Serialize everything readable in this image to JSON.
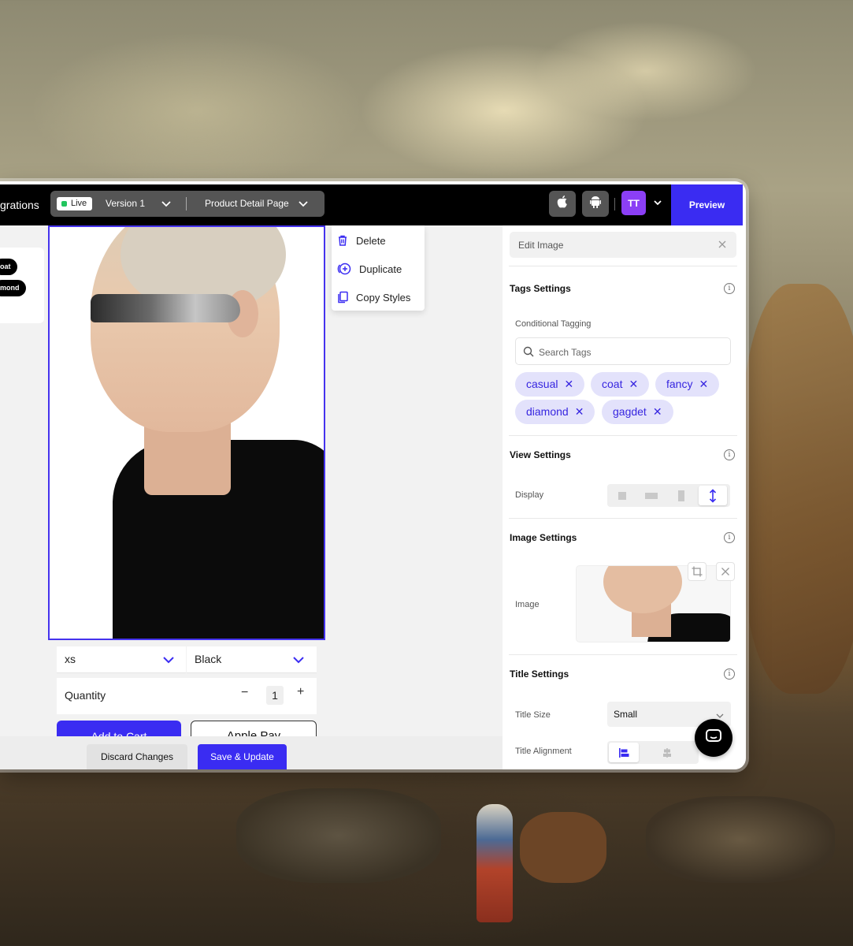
{
  "topbar": {
    "title_fragment": "grations",
    "live_label": "Live",
    "version_label": "Version 1",
    "page_label": "Product Detail Page",
    "avatar_initials": "TT",
    "preview_label": "Preview",
    "accent_color": "#3a2cf2"
  },
  "canvas": {
    "pills": [
      "oat",
      "mond"
    ],
    "size_select": "xs",
    "color_select": "Black",
    "quantity_label": "Quantity",
    "quantity_value": "1",
    "quantity_minus": "−",
    "quantity_plus": "+",
    "add_to_cart": "Add to Cart",
    "apple_pay": " Apple Pay"
  },
  "context_menu": {
    "items": [
      {
        "label": "Delete",
        "icon": "trash-icon"
      },
      {
        "label": "Duplicate",
        "icon": "plus-circle-icon"
      },
      {
        "label": "Copy Styles",
        "icon": "copy-icon"
      }
    ]
  },
  "bottombar": {
    "discard_label": "Discard Changes",
    "save_label": "Save & Update"
  },
  "panel": {
    "header": "Edit Image",
    "tags": {
      "title": "Tags Settings",
      "field_label": "Conditional Tagging",
      "search_placeholder": "Search Tags",
      "items": [
        "casual",
        "coat",
        "fancy",
        "diamond",
        "gagdet"
      ]
    },
    "view": {
      "title": "View Settings",
      "display_label": "Display"
    },
    "image": {
      "title": "Image Settings",
      "image_label": "Image"
    },
    "title_settings": {
      "title": "Title Settings",
      "size_label": "Title Size",
      "size_value": "Small",
      "alignment_label": "Title Alignment"
    }
  }
}
